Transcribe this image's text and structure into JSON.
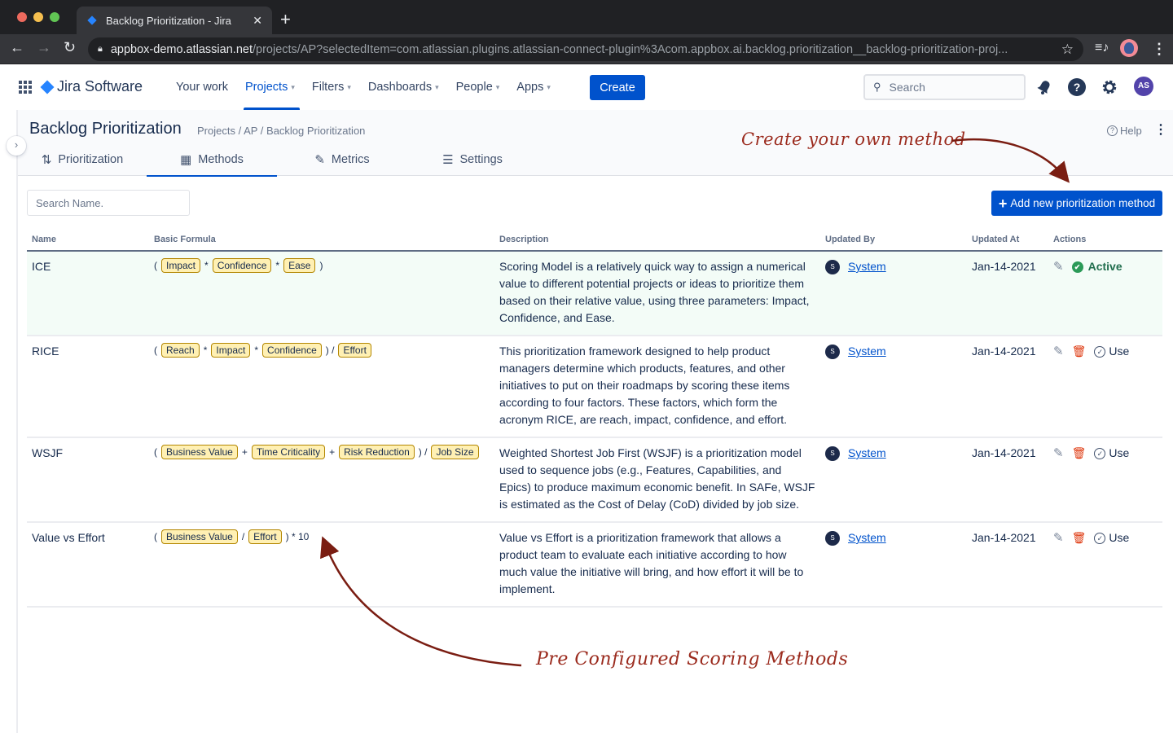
{
  "browser": {
    "tab_title": "Backlog Prioritization - Jira",
    "tab_close": "✕",
    "new_tab": "+",
    "url_host": "appbox-demo.atlassian.net",
    "url_path": "/projects/AP?selectedItem=com.atlassian.plugins.atlassian-connect-plugin%3Acom.appbox.ai.backlog.prioritization__backlog-prioritization-proj..."
  },
  "topnav": {
    "product": "Jira Software",
    "links": [
      {
        "label": "Your work",
        "dropdown": false,
        "active": false
      },
      {
        "label": "Projects",
        "dropdown": true,
        "active": true
      },
      {
        "label": "Filters",
        "dropdown": true,
        "active": false
      },
      {
        "label": "Dashboards",
        "dropdown": true,
        "active": false
      },
      {
        "label": "People",
        "dropdown": true,
        "active": false
      },
      {
        "label": "Apps",
        "dropdown": true,
        "active": false
      }
    ],
    "create_label": "Create",
    "search_placeholder": "Search",
    "avatar_initials": "AS",
    "help_glyph": "?"
  },
  "page": {
    "title": "Backlog Prioritization",
    "breadcrumb": "Projects / AP / Backlog Prioritization",
    "help_label": "Help",
    "tabs": [
      {
        "label": "Prioritization",
        "icon": "sort-icon",
        "active": false
      },
      {
        "label": "Methods",
        "icon": "calculator-icon",
        "active": true
      },
      {
        "label": "Metrics",
        "icon": "tools-icon",
        "active": false
      },
      {
        "label": "Settings",
        "icon": "sliders-icon",
        "active": false
      }
    ]
  },
  "annotations": {
    "create": "Create your own method",
    "preconfigured": "Pre Configured Scoring Methods"
  },
  "toolbar": {
    "search_placeholder": "Search Name.",
    "add_label": "Add new prioritization method"
  },
  "table": {
    "headers": {
      "name": "Name",
      "formula": "Basic Formula",
      "description": "Description",
      "updated_by": "Updated By",
      "updated_at": "Updated At",
      "actions": "Actions"
    },
    "rows": [
      {
        "name": "ICE",
        "formula": [
          "(",
          {
            "chip": "Impact"
          },
          "*",
          {
            "chip": "Confidence"
          },
          "*",
          {
            "chip": "Ease"
          },
          ")"
        ],
        "description": "Scoring Model is a relatively quick way to assign a numerical value to different potential projects or ideas to prioritize them based on their relative value, using three parameters: Impact, Confidence, and Ease.",
        "updated_by": "System",
        "updated_by_initial": "S",
        "updated_at": "Jan-14-2021",
        "status": "Active",
        "is_active": true
      },
      {
        "name": "RICE",
        "formula": [
          "(",
          {
            "chip": "Reach"
          },
          "*",
          {
            "chip": "Impact"
          },
          "*",
          {
            "chip": "Confidence"
          },
          ") /",
          {
            "chip": "Effort"
          }
        ],
        "description": "This prioritization framework designed to help product managers determine which products, features, and other initiatives to put on their roadmaps by scoring these items according to four factors. These factors, which form the acronym RICE, are reach, impact, confidence, and effort.",
        "updated_by": "System",
        "updated_by_initial": "S",
        "updated_at": "Jan-14-2021",
        "status": "Use",
        "is_active": false
      },
      {
        "name": "WSJF",
        "formula": [
          "(",
          {
            "chip": "Business Value"
          },
          "+",
          {
            "chip": "Time Criticality"
          },
          "+",
          {
            "chip": "Risk Reduction"
          },
          ") /",
          {
            "chip": "Job Size"
          }
        ],
        "description": "Weighted Shortest Job First (WSJF) is a prioritization model used to sequence jobs (e.g., Features, Capabilities, and Epics) to produce maximum economic benefit. In SAFe, WSJF is estimated as the Cost of Delay (CoD) divided by job size.",
        "updated_by": "System",
        "updated_by_initial": "S",
        "updated_at": "Jan-14-2021",
        "status": "Use",
        "is_active": false
      },
      {
        "name": "Value vs Effort",
        "formula": [
          "(",
          {
            "chip": "Business Value"
          },
          "/",
          {
            "chip": "Effort"
          },
          ") * 10"
        ],
        "description": "Value vs Effort is a prioritization framework that allows a product team to evaluate each initiative according to how much value the initiative will bring, and how effort it will be to implement.",
        "updated_by": "System",
        "updated_by_initial": "S",
        "updated_at": "Jan-14-2021",
        "status": "Use",
        "is_active": false
      }
    ]
  },
  "colors": {
    "primary": "#0052cc",
    "chip_bg": "#fff0b3",
    "chip_border": "#b38600",
    "active_green": "#216e4e",
    "delete_red": "#de350b",
    "annotation": "#9b2b1e"
  }
}
